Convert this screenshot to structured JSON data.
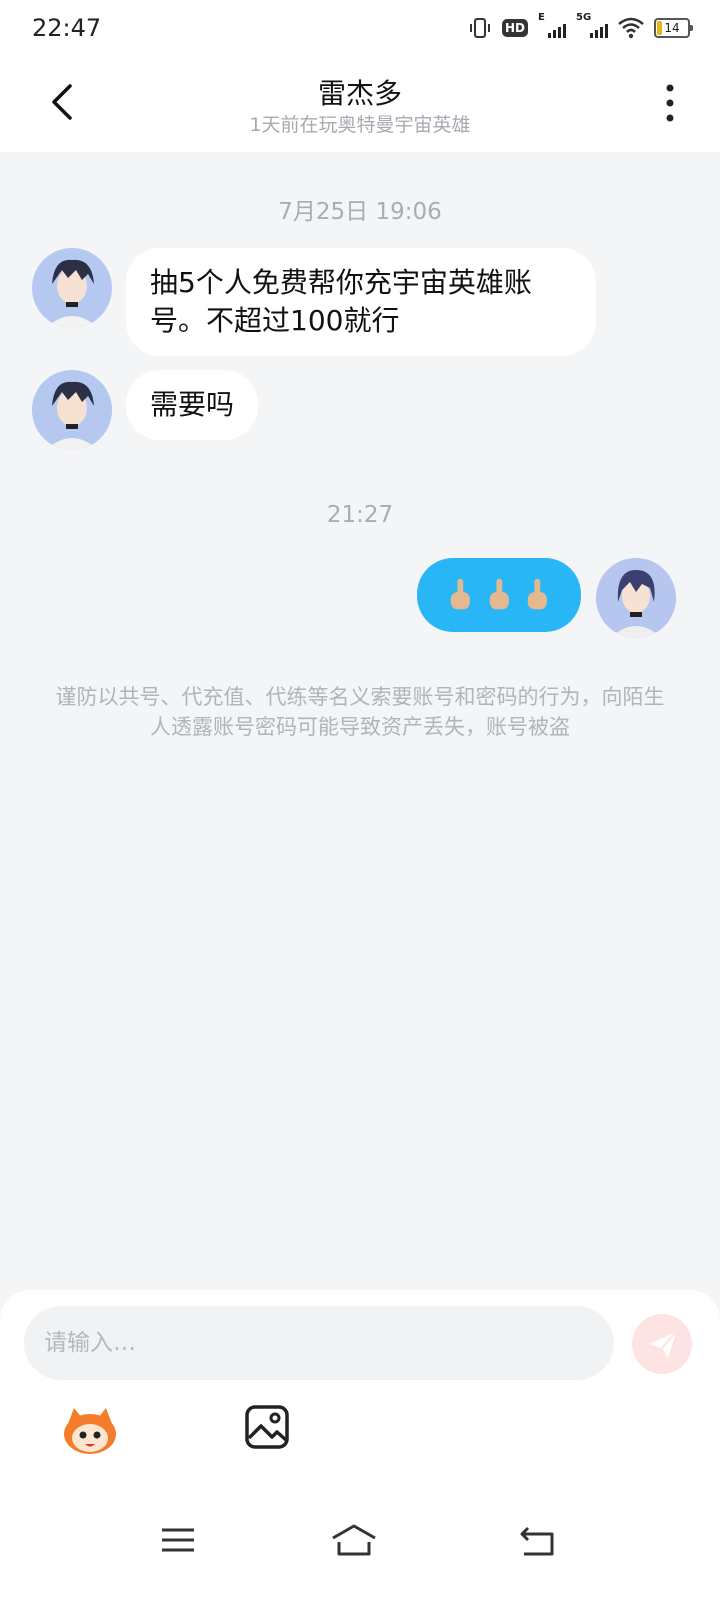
{
  "status_bar": {
    "time": "22:47",
    "battery": "14",
    "network_label_1": "E",
    "network_label_2": "5G"
  },
  "header": {
    "title": "雷杰多",
    "subtitle": "1天前在玩奥特曼宇宙英雄"
  },
  "chat": {
    "timestamp_1": "7月25日 19:06",
    "message_1": "抽5个人免费帮你充宇宙英雄账号。不超过100就行",
    "message_2": "需要吗",
    "timestamp_2": "21:27",
    "my_message_emoji": "🖕🖕🖕",
    "warning": "谨防以共号、代充值、代练等名义索要账号和密码的行为，向陌生人透露账号密码可能导致资产丢失，账号被盗"
  },
  "input": {
    "placeholder": "请输入…"
  },
  "colors": {
    "accent": "#29b6f6",
    "background": "#f4f5f7",
    "send_button": "#fde3e1"
  }
}
